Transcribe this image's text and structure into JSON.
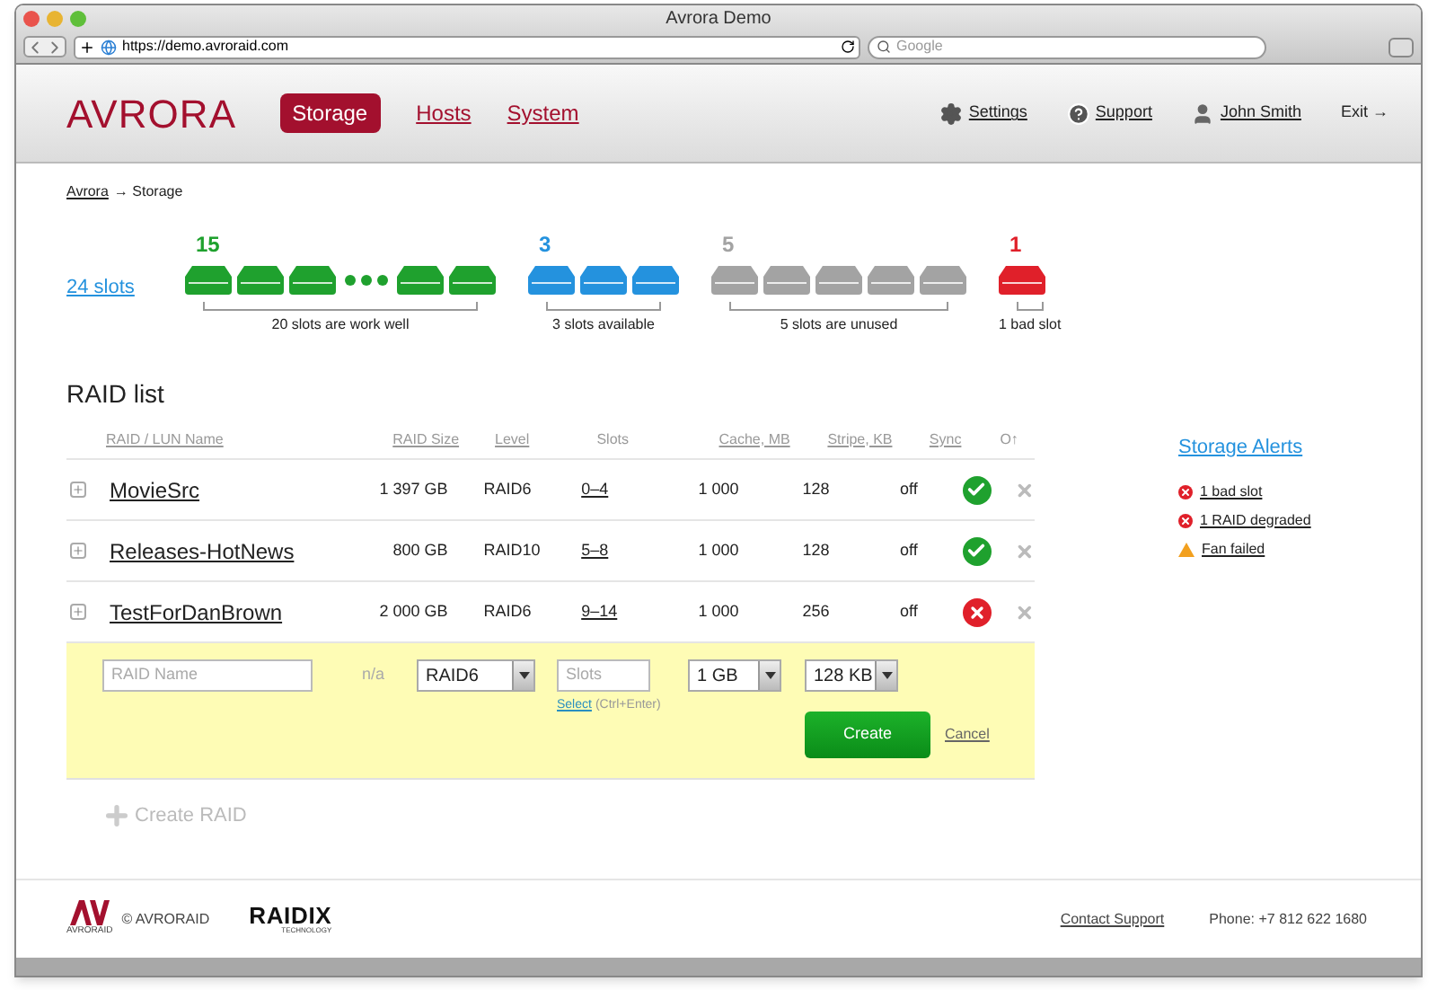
{
  "browser": {
    "title": "Avrora Demo",
    "url": "https://demo.avroraid.com",
    "search_placeholder": "Google"
  },
  "header": {
    "logo": "AVRORA",
    "nav": [
      {
        "label": "Storage",
        "selected": true
      },
      {
        "label": "Hosts",
        "selected": false
      },
      {
        "label": "System",
        "selected": false
      }
    ],
    "links": [
      {
        "kind": "settings",
        "label": "Settings"
      },
      {
        "kind": "support",
        "label": "Support"
      },
      {
        "kind": "user",
        "label": "John Smith"
      },
      {
        "kind": "exit",
        "label": "Exit →"
      }
    ]
  },
  "breadcrumb": {
    "link": "Avrora",
    "current": "→ Storage"
  },
  "slots": {
    "total": "24 slots",
    "groups": [
      {
        "count": "15",
        "caption": "20 slots are work well",
        "color": "#1fa12e",
        "slots": [
          {
            "kind": "disk"
          },
          {
            "kind": "disk"
          },
          {
            "kind": "disk"
          },
          {
            "kind": "more"
          },
          {
            "kind": "disk"
          },
          {
            "kind": "disk"
          }
        ]
      },
      {
        "count": "3",
        "caption": "3 slots available",
        "color": "#2492de",
        "slots": [
          {
            "kind": "disk"
          },
          {
            "kind": "disk"
          },
          {
            "kind": "disk"
          }
        ]
      },
      {
        "count": "5",
        "caption": "5 slots are unused",
        "color": "#a3a3a3",
        "slots": [
          {
            "kind": "disk"
          },
          {
            "kind": "disk"
          },
          {
            "kind": "disk"
          },
          {
            "kind": "disk"
          },
          {
            "kind": "disk"
          }
        ]
      },
      {
        "count": "1",
        "caption": "1 bad slot",
        "color": "#e0202a",
        "slots": [
          {
            "kind": "disk"
          }
        ]
      }
    ]
  },
  "raid_list": {
    "title": "RAID list",
    "columns": [
      "RAID / LUN Name",
      "RAID Size",
      "Level",
      "Slots",
      "Cache, MB",
      "Stripe, KB",
      "Sync",
      "O↑"
    ],
    "rows": [
      {
        "name": "MovieSrc",
        "size": "1 397 GB",
        "level": "RAID6",
        "slots": "0–4",
        "cache": "1 000",
        "stripe": "128",
        "sync": "off",
        "kind": "ok"
      },
      {
        "name": "Releases-HotNews",
        "size": "800 GB",
        "level": "RAID10",
        "slots": "5–8",
        "cache": "1 000",
        "stripe": "128",
        "sync": "off",
        "kind": "ok"
      },
      {
        "name": "TestForDanBrown",
        "size": "2 000 GB",
        "level": "RAID6",
        "slots": "9–14",
        "cache": "1 000",
        "stripe": "256",
        "sync": "off",
        "kind": "error"
      }
    ],
    "form": {
      "name_placeholder": "RAID Name",
      "size": "n/a",
      "level": "RAID6",
      "slots_placeholder": "Slots",
      "select_link": "Select",
      "select_hint": "(Ctrl+Enter)",
      "cache": "1 GB",
      "stripe": "128 KB",
      "create": "Create",
      "cancel": "Cancel"
    },
    "create_raid": "Create RAID"
  },
  "alerts": {
    "title": "Storage Alerts",
    "items": [
      {
        "kind": "error",
        "label": "1 bad slot"
      },
      {
        "kind": "error",
        "label": "1 RAID degraded"
      },
      {
        "kind": "warning",
        "label": "Fan failed"
      }
    ]
  },
  "footer": {
    "brand_small": "AVRORAID",
    "copyright": "© AVRORAID",
    "partner": "RAIDIX",
    "partner_sub": "TECHNOLOGY",
    "contact": "Contact Support",
    "phone": "Phone: +7 812 622 1680"
  }
}
